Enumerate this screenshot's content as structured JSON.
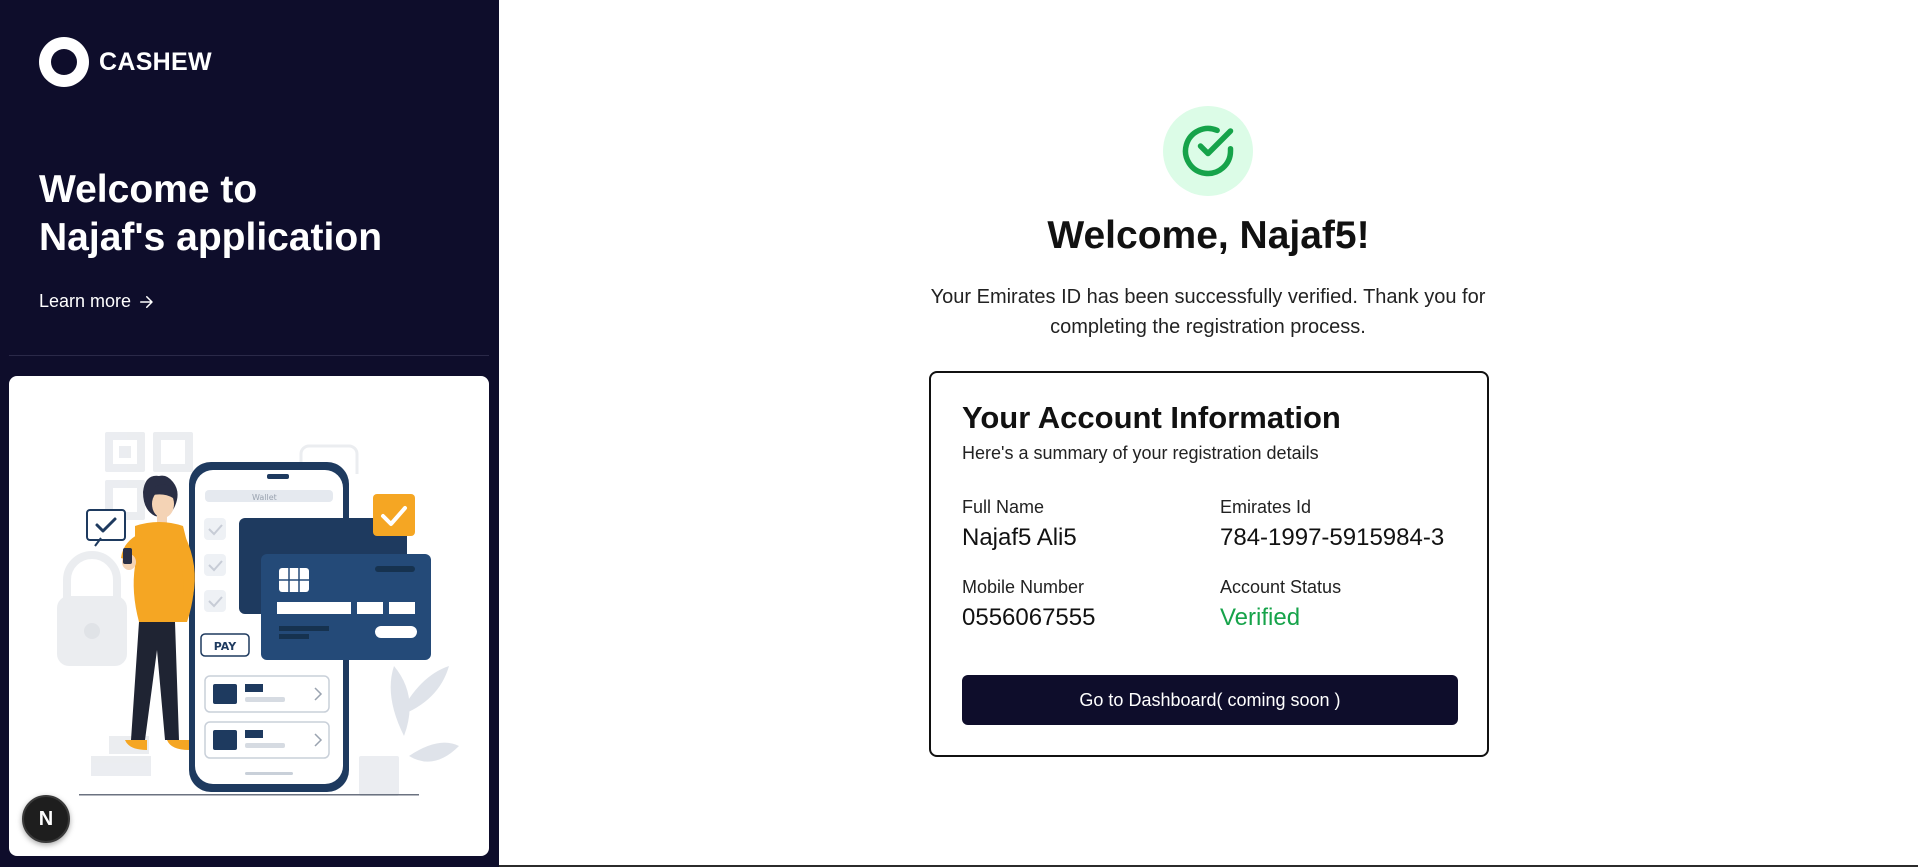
{
  "brand": {
    "name": "CASHEW"
  },
  "sidebar": {
    "hero_line1": "Welcome to",
    "hero_line2": "Najaf's application",
    "learn_more": "Learn more",
    "illustration": {
      "phone_header": "Wallet",
      "pay_label": "PAY"
    }
  },
  "main": {
    "welcome": "Welcome, Najaf5!",
    "description": "Your Emirates ID has been successfully verified. Thank you for completing the registration process.",
    "card": {
      "title": "Your Account Information",
      "subtitle": "Here's a summary of your registration details",
      "fields": [
        {
          "label": "Full Name",
          "value": "Najaf5 Ali5"
        },
        {
          "label": "Emirates Id",
          "value": "784-1997-5915984-3"
        },
        {
          "label": "Mobile Number",
          "value": "0556067555"
        },
        {
          "label": "Account Status",
          "value": "Verified"
        }
      ],
      "button": "Go to Dashboard( coming soon )"
    }
  },
  "badge": {
    "letter": "N"
  },
  "colors": {
    "sidebar_bg": "#0e0d2b",
    "success": "#16a34a",
    "success_bg": "#dcfce7",
    "accent_orange": "#f5a623",
    "card_navy": "#1e3a5f"
  }
}
